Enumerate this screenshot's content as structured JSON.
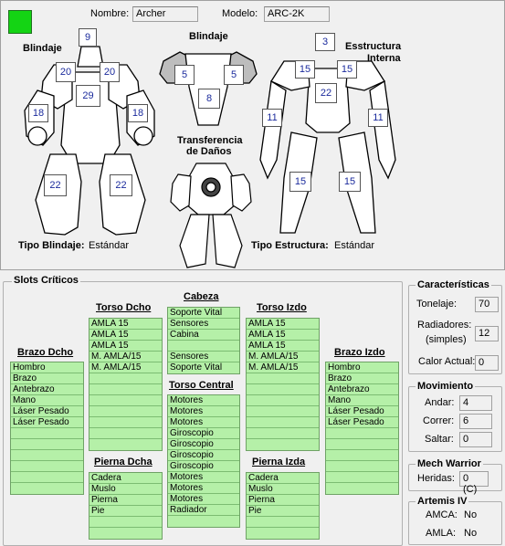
{
  "header": {
    "nombre_label": "Nombre:",
    "nombre_value": "Archer",
    "modelo_label": "Modelo:",
    "modelo_value": "ARC-2K"
  },
  "armor_front": {
    "title": "Blindaje",
    "head": "9",
    "left_torso": "20",
    "right_torso": "20",
    "center_torso": "29",
    "left_arm": "18",
    "right_arm": "18",
    "left_leg": "22",
    "right_leg": "22"
  },
  "armor_rear": {
    "title": "Blindaje",
    "left": "5",
    "right": "5",
    "center": "8"
  },
  "structure": {
    "title_line1": "Esstructura",
    "title_line2": "Interna",
    "head": "3",
    "left_torso": "15",
    "right_torso": "15",
    "center_torso": "22",
    "left_arm": "11",
    "right_arm": "11",
    "left_leg": "15",
    "right_leg": "15"
  },
  "transfer": {
    "title_line1": "Transferencia",
    "title_line2": "de Daños"
  },
  "footer": {
    "armor_type_label": "Tipo Blindaje:",
    "armor_type_value": "Estándar",
    "structure_type_label": "Tipo Estructura:",
    "structure_type_value": "Estándar"
  },
  "slots": {
    "title": "Slots Críticos",
    "brazo_dcho": {
      "title": "Brazo Dcho",
      "items": [
        "Hombro",
        "Brazo",
        "Antebrazo",
        "Mano",
        "Láser Pesado",
        "Láser Pesado",
        "",
        "",
        "",
        "",
        "",
        ""
      ]
    },
    "torso_dcho": {
      "title": "Torso Dcho",
      "items": [
        "AMLA 15",
        "AMLA 15",
        "AMLA 15",
        "M. AMLA/15",
        "M. AMLA/15",
        "",
        "",
        "",
        "",
        "",
        "",
        ""
      ]
    },
    "cabeza": {
      "title": "Cabeza",
      "items": [
        "Soporte Vital",
        "Sensores",
        "Cabina",
        "",
        "Sensores",
        "Soporte Vital"
      ]
    },
    "torso_central": {
      "title": "Torso Central",
      "items": [
        "Motores",
        "Motores",
        "Motores",
        "Giroscopio",
        "Giroscopio",
        "Giroscopio",
        "Giroscopio",
        "Motores",
        "Motores",
        "Motores",
        "Radiador",
        ""
      ]
    },
    "torso_izdo": {
      "title": "Torso Izdo",
      "items": [
        "AMLA 15",
        "AMLA 15",
        "AMLA 15",
        "M. AMLA/15",
        "M. AMLA/15",
        "",
        "",
        "",
        "",
        "",
        "",
        ""
      ]
    },
    "brazo_izdo": {
      "title": "Brazo Izdo",
      "items": [
        "Hombro",
        "Brazo",
        "Antebrazo",
        "Mano",
        "Láser Pesado",
        "Láser Pesado",
        "",
        "",
        "",
        "",
        "",
        ""
      ]
    },
    "pierna_dcha": {
      "title": "Pierna Dcha",
      "items": [
        "Cadera",
        "Muslo",
        "Pierna",
        "Pie",
        "",
        ""
      ]
    },
    "pierna_izda": {
      "title": "Pierna Izda",
      "items": [
        "Cadera",
        "Muslo",
        "Pierna",
        "Pie",
        "",
        ""
      ]
    }
  },
  "caracteristicas": {
    "title": "Características",
    "tonelaje_label": "Tonelaje:",
    "tonelaje_value": "70",
    "radiadores_label": "Radiadores:",
    "radiadores_sub": "(simples)",
    "radiadores_value": "12",
    "calor_label": "Calor Actual:",
    "calor_value": "0"
  },
  "movimiento": {
    "title": "Movimiento",
    "andar_label": "Andar:",
    "andar_value": "4",
    "correr_label": "Correr:",
    "correr_value": "6",
    "saltar_label": "Saltar:",
    "saltar_value": "0"
  },
  "mechwarrior": {
    "title": "Mech Warrior",
    "heridas_label": "Heridas:",
    "heridas_value": "0 (C)"
  },
  "artemis": {
    "title": "Artemis IV",
    "amca_label": "AMCA:",
    "amca_value": "No",
    "amla_label": "AMLA:",
    "amla_value": "No"
  },
  "colors": {
    "status": "#14d414",
    "slot_bg": "#b5f0a8",
    "armor_text": "#1a2a9c"
  }
}
